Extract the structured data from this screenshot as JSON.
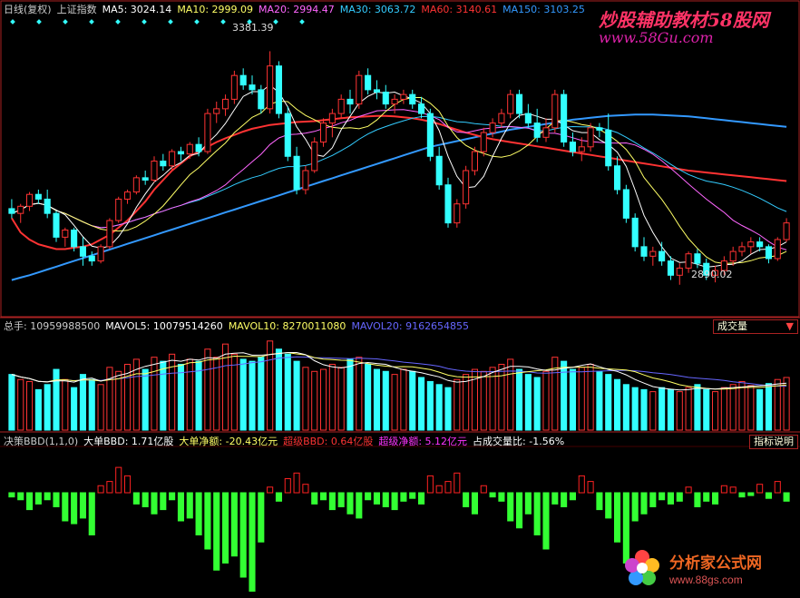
{
  "header": {
    "period": "日线(复权)",
    "index_name": "上证指数",
    "ma": [
      {
        "label": "MA5: 3024.14",
        "color": "#ffffff"
      },
      {
        "label": "MA10: 2999.09",
        "color": "#ffff66"
      },
      {
        "label": "MA20: 2994.47",
        "color": "#ff66ff"
      },
      {
        "label": "MA30: 3063.72",
        "color": "#33ccff"
      },
      {
        "label": "MA60: 3140.61",
        "color": "#ff3333"
      },
      {
        "label": "MA150: 3103.25",
        "color": "#3399ff"
      }
    ]
  },
  "annotations": {
    "high": "3381.39",
    "low": "2890.02"
  },
  "volume_panel": {
    "items": [
      {
        "label": "总手: 10959988500",
        "color": "#cccccc"
      },
      {
        "label": "MAVOL5: 10079514260",
        "color": "#ffffff"
      },
      {
        "label": "MAVOL10: 8270011080",
        "color": "#ffff66"
      },
      {
        "label": "MAVOL20: 9162654855",
        "color": "#6666ff"
      }
    ],
    "selector": "成交量"
  },
  "bbd_panel": {
    "items": [
      {
        "label": "决策BBD(1,1,0)",
        "color": "#cccccc"
      },
      {
        "label": "大单BBD: 1.71亿股",
        "color": "#ffffff"
      },
      {
        "label": "大单净额: -20.43亿元",
        "color": "#ffff66"
      },
      {
        "label": "超级BBD: 0.64亿股",
        "color": "#ff3333"
      },
      {
        "label": "超级净额: 5.12亿元",
        "color": "#ff33ff"
      },
      {
        "label": "占成交量比: -1.56%",
        "color": "#ffffff"
      }
    ],
    "help": "指标说明"
  },
  "watermarks": {
    "top_title": "炒股辅助教材58股网",
    "top_url": "www.58Gu.com",
    "bottom_title": "分析家公式网",
    "bottom_url": "www.88gs.com"
  },
  "colors": {
    "up": "#ff3333",
    "down": "#33ffff",
    "bbd_up": "#ff2222",
    "bbd_down": "#33ff33",
    "frame": "#aa2222"
  },
  "chart_data": {
    "type": "candlestick",
    "ylim": [
      2840,
      3420
    ],
    "ohlc": [
      [
        3050,
        3070,
        3030,
        3040
      ],
      [
        3040,
        3060,
        3020,
        3055
      ],
      [
        3055,
        3085,
        3045,
        3080
      ],
      [
        3080,
        3090,
        3060,
        3070
      ],
      [
        3070,
        3090,
        3030,
        3040
      ],
      [
        3040,
        3045,
        2980,
        2990
      ],
      [
        2990,
        3010,
        2970,
        3005
      ],
      [
        3005,
        3010,
        2960,
        2970
      ],
      [
        2970,
        2990,
        2930,
        2950
      ],
      [
        2950,
        2960,
        2930,
        2940
      ],
      [
        2940,
        2975,
        2935,
        2970
      ],
      [
        2970,
        3030,
        2965,
        3025
      ],
      [
        3025,
        3075,
        3020,
        3070
      ],
      [
        3070,
        3090,
        3060,
        3085
      ],
      [
        3085,
        3120,
        3080,
        3115
      ],
      [
        3115,
        3130,
        3100,
        3110
      ],
      [
        3110,
        3160,
        3105,
        3150
      ],
      [
        3150,
        3165,
        3130,
        3140
      ],
      [
        3140,
        3175,
        3130,
        3170
      ],
      [
        3170,
        3180,
        3150,
        3165
      ],
      [
        3165,
        3190,
        3155,
        3185
      ],
      [
        3185,
        3200,
        3160,
        3170
      ],
      [
        3170,
        3260,
        3165,
        3250
      ],
      [
        3250,
        3275,
        3230,
        3260
      ],
      [
        3260,
        3290,
        3245,
        3280
      ],
      [
        3280,
        3340,
        3270,
        3330
      ],
      [
        3330,
        3345,
        3300,
        3310
      ],
      [
        3310,
        3330,
        3290,
        3300
      ],
      [
        3300,
        3310,
        3250,
        3260
      ],
      [
        3260,
        3381,
        3250,
        3350
      ],
      [
        3350,
        3360,
        3240,
        3250
      ],
      [
        3250,
        3265,
        3150,
        3160
      ],
      [
        3160,
        3180,
        3080,
        3090
      ],
      [
        3090,
        3140,
        3080,
        3130
      ],
      [
        3130,
        3200,
        3125,
        3190
      ],
      [
        3190,
        3240,
        3180,
        3230
      ],
      [
        3230,
        3260,
        3200,
        3250
      ],
      [
        3250,
        3290,
        3240,
        3280
      ],
      [
        3280,
        3300,
        3250,
        3270
      ],
      [
        3270,
        3340,
        3260,
        3330
      ],
      [
        3330,
        3345,
        3290,
        3300
      ],
      [
        3300,
        3320,
        3280,
        3295
      ],
      [
        3295,
        3310,
        3260,
        3270
      ],
      [
        3270,
        3290,
        3250,
        3280
      ],
      [
        3280,
        3300,
        3270,
        3290
      ],
      [
        3290,
        3300,
        3260,
        3270
      ],
      [
        3270,
        3285,
        3240,
        3250
      ],
      [
        3250,
        3260,
        3150,
        3160
      ],
      [
        3160,
        3180,
        3090,
        3100
      ],
      [
        3100,
        3115,
        3010,
        3020
      ],
      [
        3020,
        3070,
        3010,
        3060
      ],
      [
        3060,
        3140,
        3050,
        3130
      ],
      [
        3130,
        3180,
        3120,
        3170
      ],
      [
        3170,
        3220,
        3160,
        3210
      ],
      [
        3210,
        3240,
        3200,
        3230
      ],
      [
        3230,
        3260,
        3220,
        3250
      ],
      [
        3250,
        3300,
        3240,
        3290
      ],
      [
        3290,
        3300,
        3240,
        3250
      ],
      [
        3250,
        3270,
        3220,
        3230
      ],
      [
        3230,
        3260,
        3190,
        3200
      ],
      [
        3200,
        3240,
        3190,
        3220
      ],
      [
        3220,
        3300,
        3210,
        3290
      ],
      [
        3290,
        3300,
        3180,
        3190
      ],
      [
        3190,
        3210,
        3160,
        3170
      ],
      [
        3170,
        3200,
        3150,
        3180
      ],
      [
        3180,
        3230,
        3170,
        3220
      ],
      [
        3220,
        3230,
        3200,
        3215
      ],
      [
        3215,
        3250,
        3130,
        3140
      ],
      [
        3140,
        3160,
        3080,
        3090
      ],
      [
        3090,
        3100,
        3020,
        3030
      ],
      [
        3030,
        3040,
        2960,
        2970
      ],
      [
        2970,
        2990,
        2940,
        2950
      ],
      [
        2950,
        2970,
        2930,
        2960
      ],
      [
        2960,
        2980,
        2930,
        2940
      ],
      [
        2940,
        2950,
        2900,
        2910
      ],
      [
        2910,
        2935,
        2890,
        2925
      ],
      [
        2925,
        2960,
        2915,
        2955
      ],
      [
        2955,
        2965,
        2925,
        2935
      ],
      [
        2935,
        2945,
        2900,
        2910
      ],
      [
        2910,
        2930,
        2895,
        2920
      ],
      [
        2920,
        2950,
        2910,
        2940
      ],
      [
        2940,
        2970,
        2930,
        2960
      ],
      [
        2960,
        2980,
        2950,
        2970
      ],
      [
        2970,
        2990,
        2955,
        2980
      ],
      [
        2980,
        2990,
        2960,
        2970
      ],
      [
        2970,
        2975,
        2935,
        2945
      ],
      [
        2945,
        2990,
        2940,
        2985
      ],
      [
        2985,
        3030,
        2980,
        3020
      ]
    ],
    "ma60": [
      3030,
      3000,
      2985,
      2975,
      2970,
      2965,
      2965,
      2968,
      2970,
      2975,
      2985,
      2995,
      3010,
      3025,
      3045,
      3065,
      3090,
      3110,
      3130,
      3145,
      3160,
      3170,
      3180,
      3190,
      3198,
      3205,
      3212,
      3218,
      3222,
      3226,
      3228,
      3230,
      3232,
      3233,
      3234,
      3236,
      3238,
      3240,
      3242,
      3243,
      3244,
      3245,
      3245,
      3244,
      3242,
      3240,
      3237,
      3233,
      3228,
      3222,
      3216,
      3210,
      3205,
      3200,
      3196,
      3193,
      3190,
      3187,
      3184,
      3181,
      3178,
      3175,
      3172,
      3169,
      3166,
      3163,
      3160,
      3157,
      3154,
      3151,
      3148,
      3145,
      3142,
      3139,
      3136,
      3133,
      3130,
      3128,
      3126,
      3124,
      3122,
      3120,
      3118,
      3116,
      3114,
      3112,
      3110,
      3108
    ],
    "ma150": [
      2900,
      2905,
      2910,
      2916,
      2922,
      2928,
      2934,
      2940,
      2946,
      2952,
      2958,
      2964,
      2970,
      2976,
      2982,
      2988,
      2994,
      3000,
      3006,
      3012,
      3018,
      3024,
      3030,
      3036,
      3042,
      3048,
      3054,
      3060,
      3066,
      3072,
      3078,
      3084,
      3090,
      3096,
      3102,
      3108,
      3114,
      3120,
      3126,
      3132,
      3138,
      3144,
      3150,
      3156,
      3162,
      3168,
      3174,
      3180,
      3184,
      3188,
      3192,
      3196,
      3200,
      3204,
      3208,
      3212,
      3216,
      3219,
      3222,
      3225,
      3228,
      3231,
      3234,
      3237,
      3239,
      3241,
      3243,
      3245,
      3246,
      3247,
      3248,
      3248,
      3248,
      3247,
      3246,
      3245,
      3244,
      3242,
      3240,
      3238,
      3236,
      3234,
      3232,
      3230,
      3228,
      3226,
      3224,
      3222
    ],
    "volume": [
      55,
      50,
      48,
      40,
      45,
      60,
      50,
      42,
      55,
      50,
      45,
      62,
      58,
      65,
      70,
      60,
      72,
      68,
      75,
      65,
      70,
      68,
      80,
      72,
      85,
      75,
      70,
      68,
      72,
      88,
      80,
      75,
      68,
      62,
      58,
      60,
      65,
      62,
      70,
      72,
      65,
      60,
      58,
      55,
      60,
      58,
      52,
      48,
      45,
      42,
      50,
      55,
      60,
      58,
      62,
      65,
      70,
      60,
      55,
      52,
      58,
      72,
      68,
      60,
      62,
      65,
      58,
      55,
      50,
      45,
      42,
      40,
      38,
      42,
      40,
      38,
      42,
      45,
      40,
      38,
      42,
      45,
      48,
      44,
      40,
      46,
      50,
      52
    ],
    "bbd": [
      -3,
      -5,
      -12,
      -8,
      -5,
      -10,
      -20,
      -22,
      -18,
      -30,
      5,
      8,
      18,
      12,
      -8,
      -10,
      -15,
      -12,
      -5,
      -20,
      -18,
      -30,
      -40,
      -55,
      -50,
      -45,
      -60,
      -70,
      -35,
      4,
      -6,
      10,
      14,
      6,
      -8,
      -5,
      -12,
      -10,
      -15,
      -18,
      -5,
      -8,
      -10,
      -12,
      -6,
      -4,
      -8,
      12,
      5,
      8,
      14,
      -10,
      -15,
      5,
      -3,
      -6,
      -20,
      -25,
      -15,
      -30,
      -40,
      -8,
      -10,
      -5,
      12,
      8,
      -12,
      -18,
      -35,
      -50,
      -20,
      -15,
      -10,
      -5,
      -8,
      -6,
      4,
      -10,
      -6,
      -8,
      5,
      4,
      -3,
      -2,
      6,
      -4,
      8,
      -6
    ]
  }
}
